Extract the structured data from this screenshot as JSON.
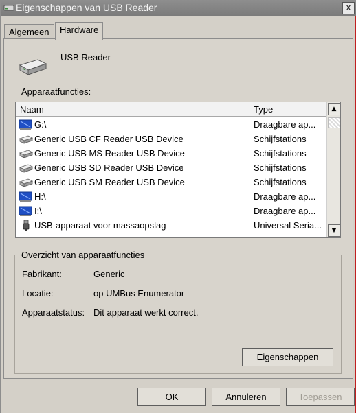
{
  "window": {
    "title": "Eigenschappen van USB Reader",
    "close_label": "x"
  },
  "tabs": [
    {
      "label": "Algemeen"
    },
    {
      "label": "Hardware"
    }
  ],
  "device": {
    "name": "USB Reader"
  },
  "functions": {
    "section_label": "Apparaatfuncties:",
    "columns": [
      "Naam",
      "Type"
    ],
    "rows": [
      {
        "icon": "portable-device-icon",
        "name": "G:\\",
        "type": "Draagbare ap..."
      },
      {
        "icon": "disk-drive-icon",
        "name": "Generic USB CF Reader USB Device",
        "type": "Schijfstations"
      },
      {
        "icon": "disk-drive-icon",
        "name": "Generic USB MS Reader USB Device",
        "type": "Schijfstations"
      },
      {
        "icon": "disk-drive-icon",
        "name": "Generic USB SD Reader USB Device",
        "type": "Schijfstations"
      },
      {
        "icon": "disk-drive-icon",
        "name": "Generic USB SM Reader USB Device",
        "type": "Schijfstations"
      },
      {
        "icon": "portable-device-icon",
        "name": "H:\\",
        "type": "Draagbare ap..."
      },
      {
        "icon": "portable-device-icon",
        "name": "I:\\",
        "type": "Draagbare ap..."
      },
      {
        "icon": "usb-plug-icon",
        "name": "USB-apparaat voor massaopslag",
        "type": "Universal Seria..."
      }
    ]
  },
  "summary": {
    "title": "Overzicht van apparaatfuncties",
    "manufacturer_label": "Fabrikant:",
    "manufacturer_value": "Generic",
    "location_label": "Locatie:",
    "location_value": "op UMBus Enumerator",
    "status_label": "Apparaatstatus:",
    "status_value": "Dit apparaat werkt correct.",
    "properties_button": "Eigenschappen"
  },
  "footer": {
    "ok": "OK",
    "cancel": "Annuleren",
    "apply": "Toepassen"
  },
  "colors": {
    "titlebar": "#808080",
    "dialog_bg": "#d4d0c8",
    "list_bg": "#ffffff",
    "disabled_text": "#a09c94"
  }
}
